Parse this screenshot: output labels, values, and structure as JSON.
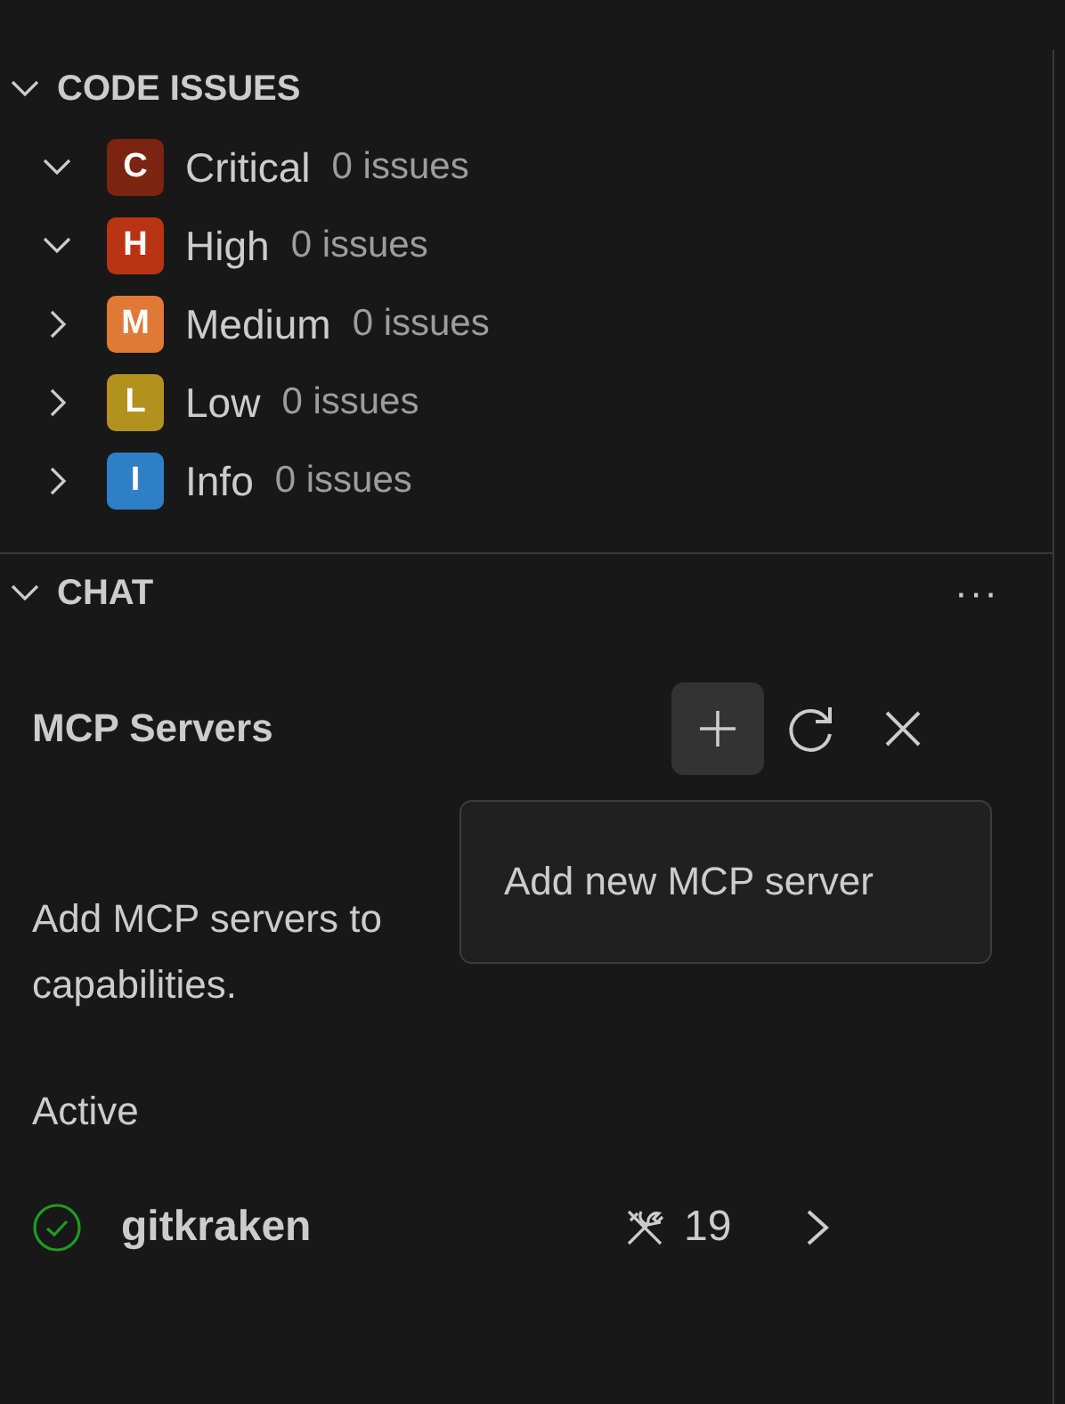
{
  "code_issues": {
    "title": "CODE ISSUES",
    "expanded": true,
    "items": [
      {
        "letter": "C",
        "label": "Critical",
        "count": "0 issues",
        "color": "#7b2410",
        "expanded": true
      },
      {
        "letter": "H",
        "label": "High",
        "count": "0 issues",
        "color": "#b93413",
        "expanded": true
      },
      {
        "letter": "M",
        "label": "Medium",
        "count": "0 issues",
        "color": "#e07935",
        "expanded": false
      },
      {
        "letter": "L",
        "label": "Low",
        "count": "0 issues",
        "color": "#b3911f",
        "expanded": false
      },
      {
        "letter": "I",
        "label": "Info",
        "count": "0 issues",
        "color": "#2f7fc6",
        "expanded": false
      }
    ]
  },
  "chat": {
    "title": "CHAT",
    "expanded": true,
    "more": "···",
    "mcp": {
      "title": "MCP Servers",
      "description_lines": [
        "Add MCP servers to",
        "capabilities."
      ],
      "tooltip": "Add new MCP server",
      "active_heading": "Active",
      "servers": [
        {
          "name": "gitkraken",
          "tools": "19",
          "connected": true
        }
      ]
    }
  }
}
